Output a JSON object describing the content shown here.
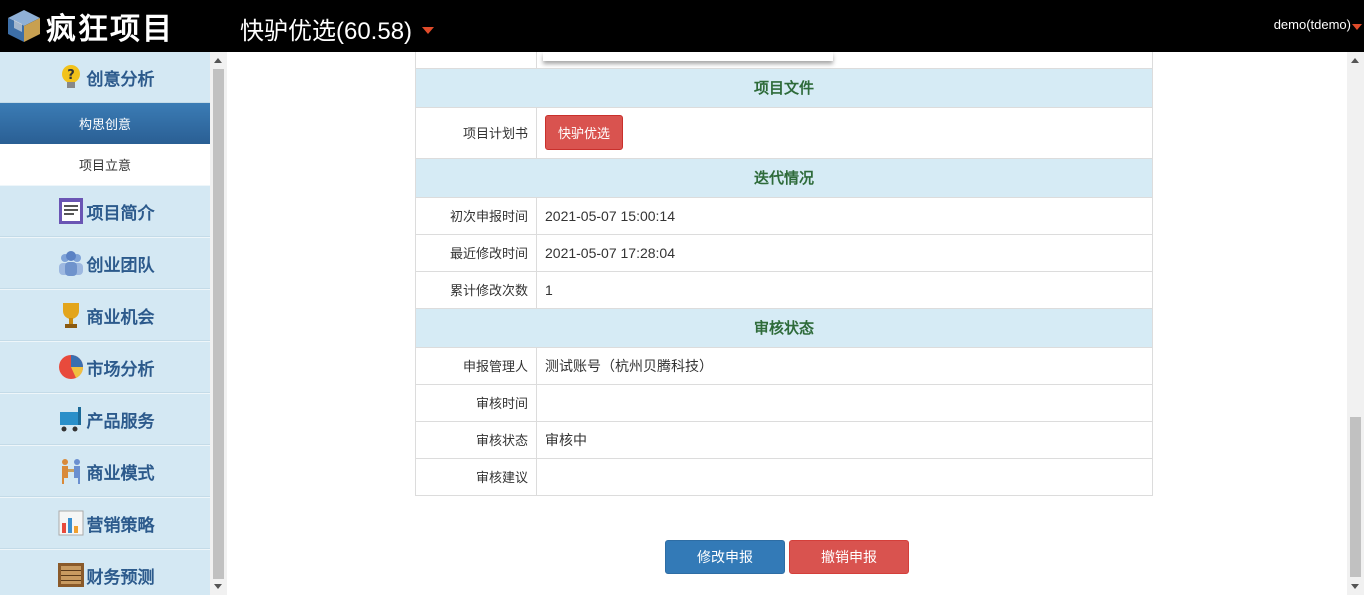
{
  "header": {
    "logo_text": "疯狂项目",
    "project_title": "快驴优选(60.58)",
    "user": "demo(tdemo)"
  },
  "sidebar": {
    "groups": [
      {
        "label": "创意分析",
        "icon": "lightbulb-question-icon"
      },
      {
        "label": "项目简介",
        "icon": "document-icon"
      },
      {
        "label": "创业团队",
        "icon": "team-icon"
      },
      {
        "label": "商业机会",
        "icon": "trophy-icon"
      },
      {
        "label": "市场分析",
        "icon": "pie-chart-icon"
      },
      {
        "label": "产品服务",
        "icon": "cart-icon"
      },
      {
        "label": "商业模式",
        "icon": "handshake-icon"
      },
      {
        "label": "营销策略",
        "icon": "bar-chart-icon"
      },
      {
        "label": "财务预测",
        "icon": "abacus-icon"
      }
    ],
    "subitems": [
      {
        "label": "构思创意",
        "active": true
      },
      {
        "label": "项目立意",
        "active": false
      }
    ]
  },
  "sections": {
    "files": {
      "title": "项目文件",
      "plan_label": "项目计划书",
      "plan_button": "快驴优选"
    },
    "iteration": {
      "title": "迭代情况",
      "rows": [
        {
          "key": "初次申报时间",
          "value": "2021-05-07 15:00:14"
        },
        {
          "key": "最近修改时间",
          "value": "2021-05-07 17:28:04"
        },
        {
          "key": "累计修改次数",
          "value": "1"
        }
      ]
    },
    "review": {
      "title": "审核状态",
      "rows": [
        {
          "key": "申报管理人",
          "value": "测试账号（杭州贝腾科技）"
        },
        {
          "key": "审核时间",
          "value": ""
        },
        {
          "key": "审核状态",
          "value": "审核中"
        },
        {
          "key": "审核建议",
          "value": ""
        }
      ]
    }
  },
  "actions": {
    "modify": "修改申报",
    "revoke": "撤销申报"
  },
  "colors": {
    "header_bg": "#000000",
    "accent_blue": "#337ab7",
    "accent_red": "#d9534f",
    "section_bg": "#d6ebf5",
    "caret": "#e04b2a"
  }
}
